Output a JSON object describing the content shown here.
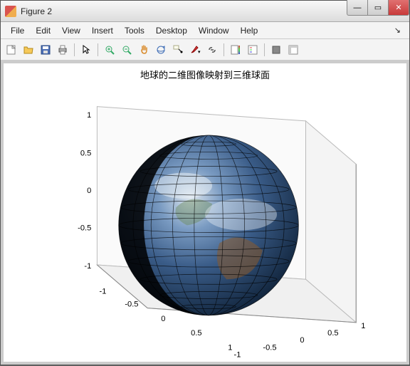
{
  "window": {
    "title": "Figure 2"
  },
  "menu": {
    "file": "File",
    "edit": "Edit",
    "view": "View",
    "insert": "Insert",
    "tools": "Tools",
    "desktop": "Desktop",
    "window": "Window",
    "help": "Help"
  },
  "toolbar": {
    "new": "new-figure",
    "open": "open",
    "save": "save",
    "print": "print",
    "pointer": "edit-plot",
    "zoom_in": "zoom-in",
    "zoom_out": "zoom-out",
    "pan": "pan",
    "rotate3d": "rotate-3d",
    "datacursor": "data-cursor",
    "brush": "brush",
    "link": "link",
    "colorbar": "insert-colorbar",
    "legend": "insert-legend",
    "hide": "hide-plot-tools",
    "show": "show-plot-tools"
  },
  "plot": {
    "title": "地球的二维图像映射到三维球面",
    "z_ticks": [
      "1",
      "0.5",
      "0",
      "-0.5",
      "-1"
    ],
    "x_ticks": [
      "-1",
      "-0.5",
      "0",
      "0.5",
      "1"
    ],
    "y_ticks": [
      "-1",
      "-0.5",
      "0",
      "0.5",
      "1"
    ]
  },
  "chart_data": {
    "type": "surface",
    "kind": "3d-sphere-texture-map",
    "xlim": [
      -1,
      1
    ],
    "ylim": [
      -1,
      1
    ],
    "zlim": [
      -1,
      1
    ],
    "radius": 1,
    "grid": true,
    "texture": "earth-visible-spectrum"
  }
}
